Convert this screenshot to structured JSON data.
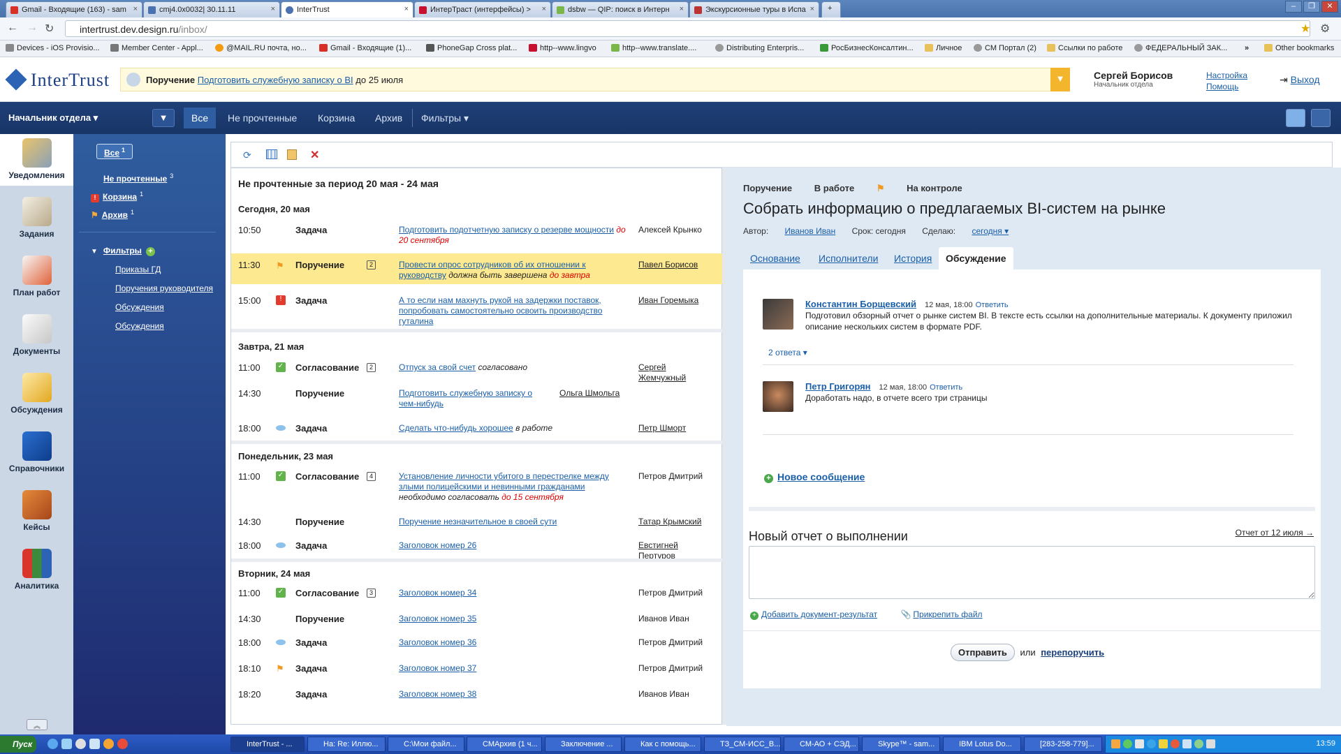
{
  "browser": {
    "tabs": [
      {
        "title": "Gmail - Входящие (163) - sam",
        "color": "#d93025"
      },
      {
        "title": "cmj4.0x0032| 30.11.11",
        "color": "#4a72b0"
      },
      {
        "title": "InterTrust",
        "color": "#4a72b0",
        "active": true
      },
      {
        "title": "ИнтерТраст (интерфейсы) >",
        "color": "#c8102e"
      },
      {
        "title": "dsbw — QIP: поиск в Интерн",
        "color": "#7ab648"
      },
      {
        "title": "Экскурсионные туры в Испа",
        "color": "#b33"
      }
    ],
    "url_host": "intertrust.dev.design.ru",
    "url_path": "/inbox/",
    "bookmarks": [
      "Devices - iOS Provisio...",
      "Member Center - Appl...",
      "@MAIL.RU почта, но...",
      "Gmail - Входящие (1)...",
      "PhoneGap  Cross plat...",
      "http--www.lingvo",
      "http--www.translate....",
      "Distributing Enterpris...",
      "РосБизнесКонсалтин...",
      "Личное",
      "СМ Портал (2)",
      "Ссылки по работе",
      "ФЕДЕРАЛЬНЫЙ ЗАК...",
      "Other bookmarks"
    ]
  },
  "header": {
    "logo": "InterTrust",
    "notice_type": "Поручение",
    "notice_link": "Подготовить служебную записку о BI",
    "notice_due": "до 25 июля",
    "user_name": "Сергей Борисов",
    "user_role": "Начальник отдела",
    "settings": "Настройка",
    "help": "Помощь",
    "logout": "Выход"
  },
  "nav": {
    "dept": "Начальник отдела ▾",
    "tabs": [
      "Все",
      "Не прочтенные",
      "Корзина",
      "Архив"
    ],
    "filters": "Фильтры ▾"
  },
  "rail": [
    "Уведомления",
    "Задания",
    "План работ",
    "Документы",
    "Обсуждения",
    "Справочники",
    "Кейсы",
    "Аналитика"
  ],
  "folders": {
    "all": "Все",
    "all_count": "1",
    "unread": "Не прочтенные",
    "unread_count": "3",
    "trash": "Корзина",
    "trash_count": "1",
    "archive": "Архив",
    "archive_count": "1",
    "filters": "Фильтры",
    "subfilters": [
      "Приказы ГД",
      "Поручения руководителя",
      "Обсуждения",
      "Обсуждения"
    ]
  },
  "list": {
    "header": "Не прочтенные за период 20 мая - 24 мая",
    "days": [
      "Сегодня, 20 мая",
      "Завтра, 21 мая",
      "Понедельник, 23 мая",
      "Вторник, 24 мая"
    ],
    "rows": [
      {
        "time": "10:50",
        "type": "Задача",
        "desc": "Подготовить подотчетную записку о резерве мощности",
        "deadline": "до 20 сентября",
        "who": "Алексей Крынко"
      },
      {
        "time": "11:30",
        "type": "Поручение",
        "count": "2",
        "desc": "Провести опрос сотрудников об их отношении к руководству",
        "status": "должна быть завершена",
        "deadline": "до завтра",
        "who": "Павел Борисов"
      },
      {
        "time": "15:00",
        "type": "Задача",
        "desc": "А то если нам махнуть рукой на задержки поставок, попробовать самостоятельно освоить производство гуталина",
        "who": "Иван Горемыка"
      },
      {
        "time": "11:00",
        "type": "Согласование",
        "count": "2",
        "desc": "Отпуск за свой счет",
        "status": "согласовано",
        "who": "Сергей Жемчужный"
      },
      {
        "time": "14:30",
        "type": "Поручение",
        "desc": "Подготовить служебную записку о чем-нибудь",
        "who": "Ольга Шмольга"
      },
      {
        "time": "18:00",
        "type": "Задача",
        "desc": "Сделать что-нибудь хорошее",
        "status": "в работе",
        "who": "Петр Шморт"
      },
      {
        "time": "11:00",
        "type": "Согласование",
        "count": "4",
        "desc": "Установление личности убитого в перестрелке между злыми полицейскими и невинными гражданами",
        "status": "необходимо согласовать",
        "deadline": "до 15 сентября",
        "who": "Петров Дмитрий"
      },
      {
        "time": "14:30",
        "type": "Поручение",
        "desc": "Поручение незначительное в своей сути",
        "who": "Татар Крымский"
      },
      {
        "time": "18:00",
        "type": "Задача",
        "desc": "Заголовок номер 26",
        "who": "Евстигней Пертуров"
      },
      {
        "time": "11:00",
        "type": "Согласование",
        "count": "3",
        "desc": "Заголовок номер 34",
        "who": "Петров Дмитрий"
      },
      {
        "time": "14:30",
        "type": "Поручение",
        "desc": "Заголовок номер 35",
        "who": "Иванов Иван"
      },
      {
        "time": "18:00",
        "type": "Задача",
        "desc": "Заголовок номер 36",
        "who": "Петров Дмитрий"
      },
      {
        "time": "18:10",
        "type": "Задача",
        "desc": "Заголовок номер 37",
        "who": "Петров Дмитрий"
      },
      {
        "time": "18:20",
        "type": "Задача",
        "desc": "Заголовок номер 38",
        "who": "Иванов Иван"
      }
    ]
  },
  "detail": {
    "kind": "Поручение",
    "state": "В работе",
    "control": "На контроле",
    "title": "Собрать информацию о предлагаемых BI-систем на рынке",
    "author_label": "Автор:",
    "author": "Иванов Иван",
    "due_label": "Срок: сегодня",
    "done_label": "Сделаю:",
    "done": "сегодня ▾",
    "tabs": [
      "Основание",
      "Исполнители",
      "История",
      "Обсуждение"
    ],
    "messages": [
      {
        "author": "Константин Борщевский",
        "time": "12 мая, 18:00",
        "reply": "Ответить",
        "text": "Подготовил обзорный отчет о рынке систем BI. В тексте есть ссылки на дополнительные материалы. К документу приложил описание нескольких систем в формате PDF."
      },
      {
        "author": "Петр Григорян",
        "time": "12 мая, 18:00",
        "reply": "Ответить",
        "text": "Доработать надо, в отчете всего три страницы"
      }
    ],
    "replies": "2 ответа ▾",
    "new_message": "Новое сообщение",
    "report_title": "Новый отчет о выполнении",
    "report_from": "Отчет от 12 июля →",
    "add_doc": "Добавить документ-результат",
    "attach": "Прикрепить файл",
    "send": "Отправить",
    "or": "или",
    "reassign": "перепоручить"
  },
  "taskbar": {
    "start": "Пуск",
    "items": [
      "InterTrust - ...",
      "На: Re: Иллю...",
      "C:\\Мои файл...",
      "СМАрхив (1 ч...",
      "Заключение ...",
      "Как с помощь...",
      "ТЗ_СМ-ИСС_В...",
      "СМ-АО + СЭД...",
      "Skype™ - sam...",
      "IBM Lotus Do...",
      "[283-258-779]..."
    ],
    "clock": "13:59"
  }
}
